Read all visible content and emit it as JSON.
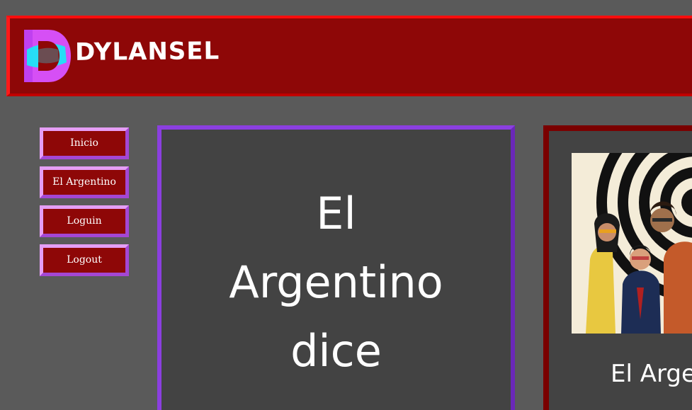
{
  "header": {
    "brand_name": "DYLANSEL",
    "logo_icon": "d-logo-icon"
  },
  "nav": {
    "items": [
      {
        "label": "Inicio"
      },
      {
        "label": "El Argentino"
      },
      {
        "label": "Loguin"
      },
      {
        "label": "Logout"
      }
    ]
  },
  "main": {
    "title_lines": [
      "El",
      "Argentino",
      "dice"
    ]
  },
  "side": {
    "image_icon": "group-photo-image",
    "caption": "El Arge"
  },
  "colors": {
    "background": "#5a5a5a",
    "header_bg": "#8e0707",
    "header_border": "#ff0d0d",
    "nav_btn_bg": "#8e0707",
    "nav_btn_border": "#c95fec",
    "panel_bg": "#434343",
    "main_panel_border": "#8b3fe0",
    "side_panel_border": "#7a0000"
  }
}
